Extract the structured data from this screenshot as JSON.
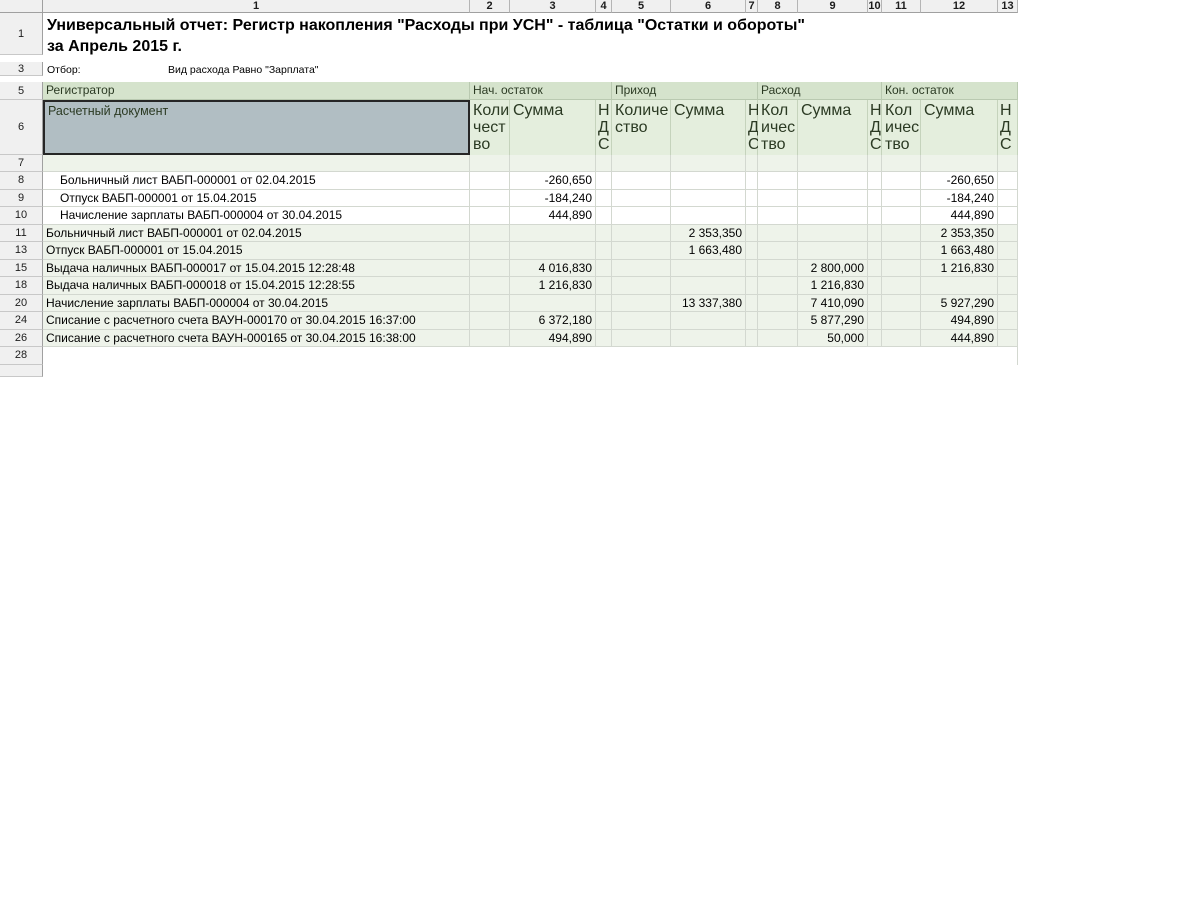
{
  "columns": [
    "1",
    "2",
    "3",
    "4",
    "5",
    "6",
    "7",
    "8",
    "9",
    "10",
    "11",
    "12",
    "13"
  ],
  "row_numbers": [
    "1",
    "3",
    "5",
    "6",
    "7",
    "8",
    "9",
    "10",
    "11",
    "13",
    "15",
    "18",
    "20",
    "24",
    "26",
    "28"
  ],
  "report": {
    "title_line1": "Универсальный отчет: Регистр накопления \"Расходы при УСН\" - таблица \"Остатки и обороты\"",
    "title_line2": "за Апрель 2015 г.",
    "filter_label": "Отбор:",
    "filter_value": "Вид расхода Равно \"Зарплата\""
  },
  "header": {
    "registrar": "Регистратор",
    "start_balance": "Нач. остаток",
    "income": "Приход",
    "expense": "Расход",
    "end_balance": "Кон. остаток",
    "document": "Расчетный документ",
    "qty_start": "Коли\nчест\nво",
    "sum_start": "Сумма",
    "nds_start": "Н\nД\nС",
    "qty_income": "Количе\nство",
    "sum_income": "Сумма",
    "nds_income": "Н\nД\nС",
    "qty_expense": "Кол\nичес\nтво",
    "sum_expense": "Сумма",
    "nds_expense": "Н\nД\nС",
    "qty_end": "Кол\nичес\nтво",
    "sum_end": "Сумма",
    "nds_end": "Н\nД\nС"
  },
  "rows": [
    {
      "label": "Больничный лист ВАБП-000001 от 02.04.2015",
      "start": "-260,650",
      "income": "",
      "expense": "",
      "end": "-260,650"
    },
    {
      "label": "Отпуск ВАБП-000001 от 15.04.2015",
      "start": "-184,240",
      "income": "",
      "expense": "",
      "end": "-184,240"
    },
    {
      "label": "Начисление зарплаты ВАБП-000004 от 30.04.2015",
      "start": "444,890",
      "income": "",
      "expense": "",
      "end": "444,890"
    },
    {
      "label": "Больничный лист ВАБП-000001 от 02.04.2015",
      "start": "",
      "income": "2 353,350",
      "expense": "",
      "end": "2 353,350"
    },
    {
      "label": "Отпуск ВАБП-000001 от 15.04.2015",
      "start": "",
      "income": "1 663,480",
      "expense": "",
      "end": "1 663,480"
    },
    {
      "label": "Выдача наличных ВАБП-000017 от 15.04.2015 12:28:48",
      "start": "4 016,830",
      "income": "",
      "expense": "2 800,000",
      "end": "1 216,830"
    },
    {
      "label": "Выдача наличных ВАБП-000018 от 15.04.2015 12:28:55",
      "start": "1 216,830",
      "income": "",
      "expense": "1 216,830",
      "end": ""
    },
    {
      "label": "Начисление зарплаты ВАБП-000004 от 30.04.2015",
      "start": "",
      "income": "13 337,380",
      "expense": "7 410,090",
      "end": "5 927,290"
    },
    {
      "label": "Списание с расчетного счета ВАУН-000170 от 30.04.2015 16:37:00",
      "start": "6 372,180",
      "income": "",
      "expense": "5 877,290",
      "end": "494,890"
    },
    {
      "label": "Списание с расчетного счета ВАУН-000165 от 30.04.2015 16:38:00",
      "start": "494,890",
      "income": "",
      "expense": "50,000",
      "end": "444,890"
    }
  ]
}
